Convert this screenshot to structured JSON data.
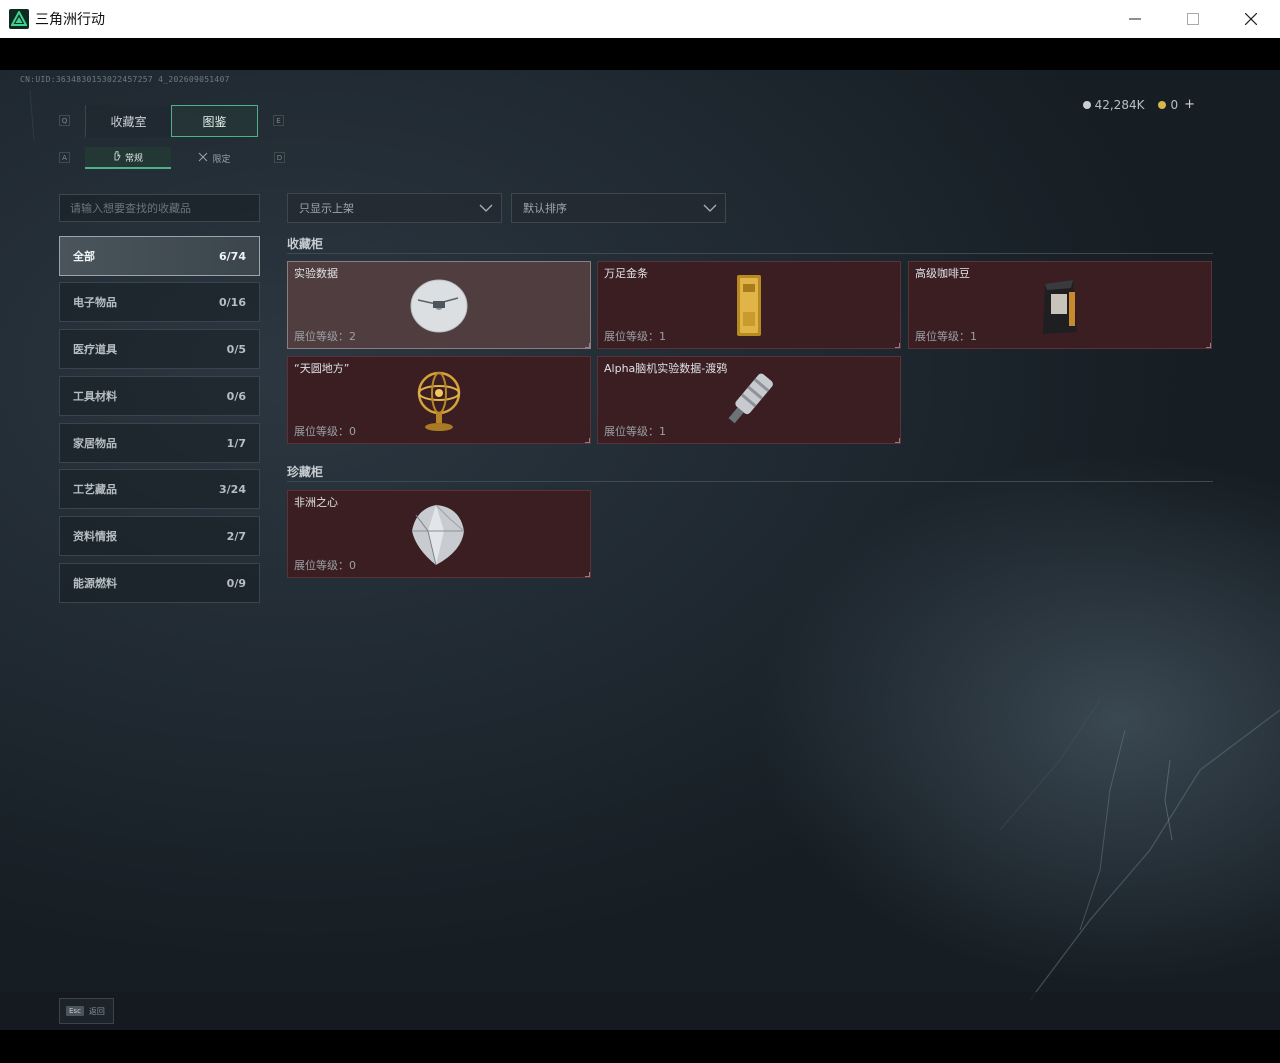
{
  "window": {
    "title": "三角洲行动",
    "controls": [
      "minimize-icon",
      "maximize-icon",
      "close-icon"
    ]
  },
  "header": {
    "uid": "CN:UID:3634830153022457257 4_202609051407",
    "currency": [
      {
        "icon": "silver-coin-icon",
        "value": "42,284K",
        "color": "#c9ced2"
      },
      {
        "icon": "gold-coin-icon",
        "value": "0",
        "color": "#d8b44a"
      }
    ],
    "add_label": "+"
  },
  "tabs": {
    "left_key": "Q",
    "right_key": "E",
    "items": [
      {
        "label": "收藏室",
        "active": false
      },
      {
        "label": "图鉴",
        "active": true
      }
    ]
  },
  "subtabs": {
    "left_key": "A",
    "right_key": "D",
    "items": [
      {
        "label": "常规",
        "icon": "hand-icon",
        "active": true
      },
      {
        "label": "限定",
        "icon": "swords-icon",
        "active": false
      }
    ]
  },
  "search": {
    "placeholder": "请输入想要查找的收藏品"
  },
  "filters": {
    "show": "只显示上架",
    "sort": "默认排序"
  },
  "categories": [
    {
      "label": "全部",
      "count": "6/74",
      "active": true
    },
    {
      "label": "电子物品",
      "count": "0/16",
      "active": false
    },
    {
      "label": "医疗道具",
      "count": "0/5",
      "active": false
    },
    {
      "label": "工具材料",
      "count": "0/6",
      "active": false
    },
    {
      "label": "家居物品",
      "count": "1/7",
      "active": false
    },
    {
      "label": "工艺藏品",
      "count": "3/24",
      "active": false
    },
    {
      "label": "资料情报",
      "count": "2/7",
      "active": false
    },
    {
      "label": "能源燃料",
      "count": "0/9",
      "active": false
    }
  ],
  "sections": [
    {
      "title": "收藏柜",
      "items": [
        {
          "name": "实验数据",
          "level": "展位等级：2",
          "icon": "data-disc-icon",
          "selected": true
        },
        {
          "name": "万足金条",
          "level": "展位等级：1",
          "icon": "gold-bar-icon",
          "selected": false
        },
        {
          "name": "高级咖啡豆",
          "level": "展位等级：1",
          "icon": "coffee-bag-icon",
          "selected": false
        },
        {
          "name": "“天圆地方”",
          "level": "展位等级：0",
          "icon": "armillary-sphere-icon",
          "selected": false
        },
        {
          "name": "Alpha脑机实验数据-渡鸦",
          "level": "展位等级：1",
          "icon": "data-drive-icon",
          "selected": false
        }
      ]
    },
    {
      "title": "珍藏柜",
      "items": [
        {
          "name": "非洲之心",
          "level": "展位等级：0",
          "icon": "diamond-icon",
          "selected": false
        }
      ]
    }
  ],
  "footer": {
    "esc_key": "Esc",
    "back_label": "返回"
  }
}
